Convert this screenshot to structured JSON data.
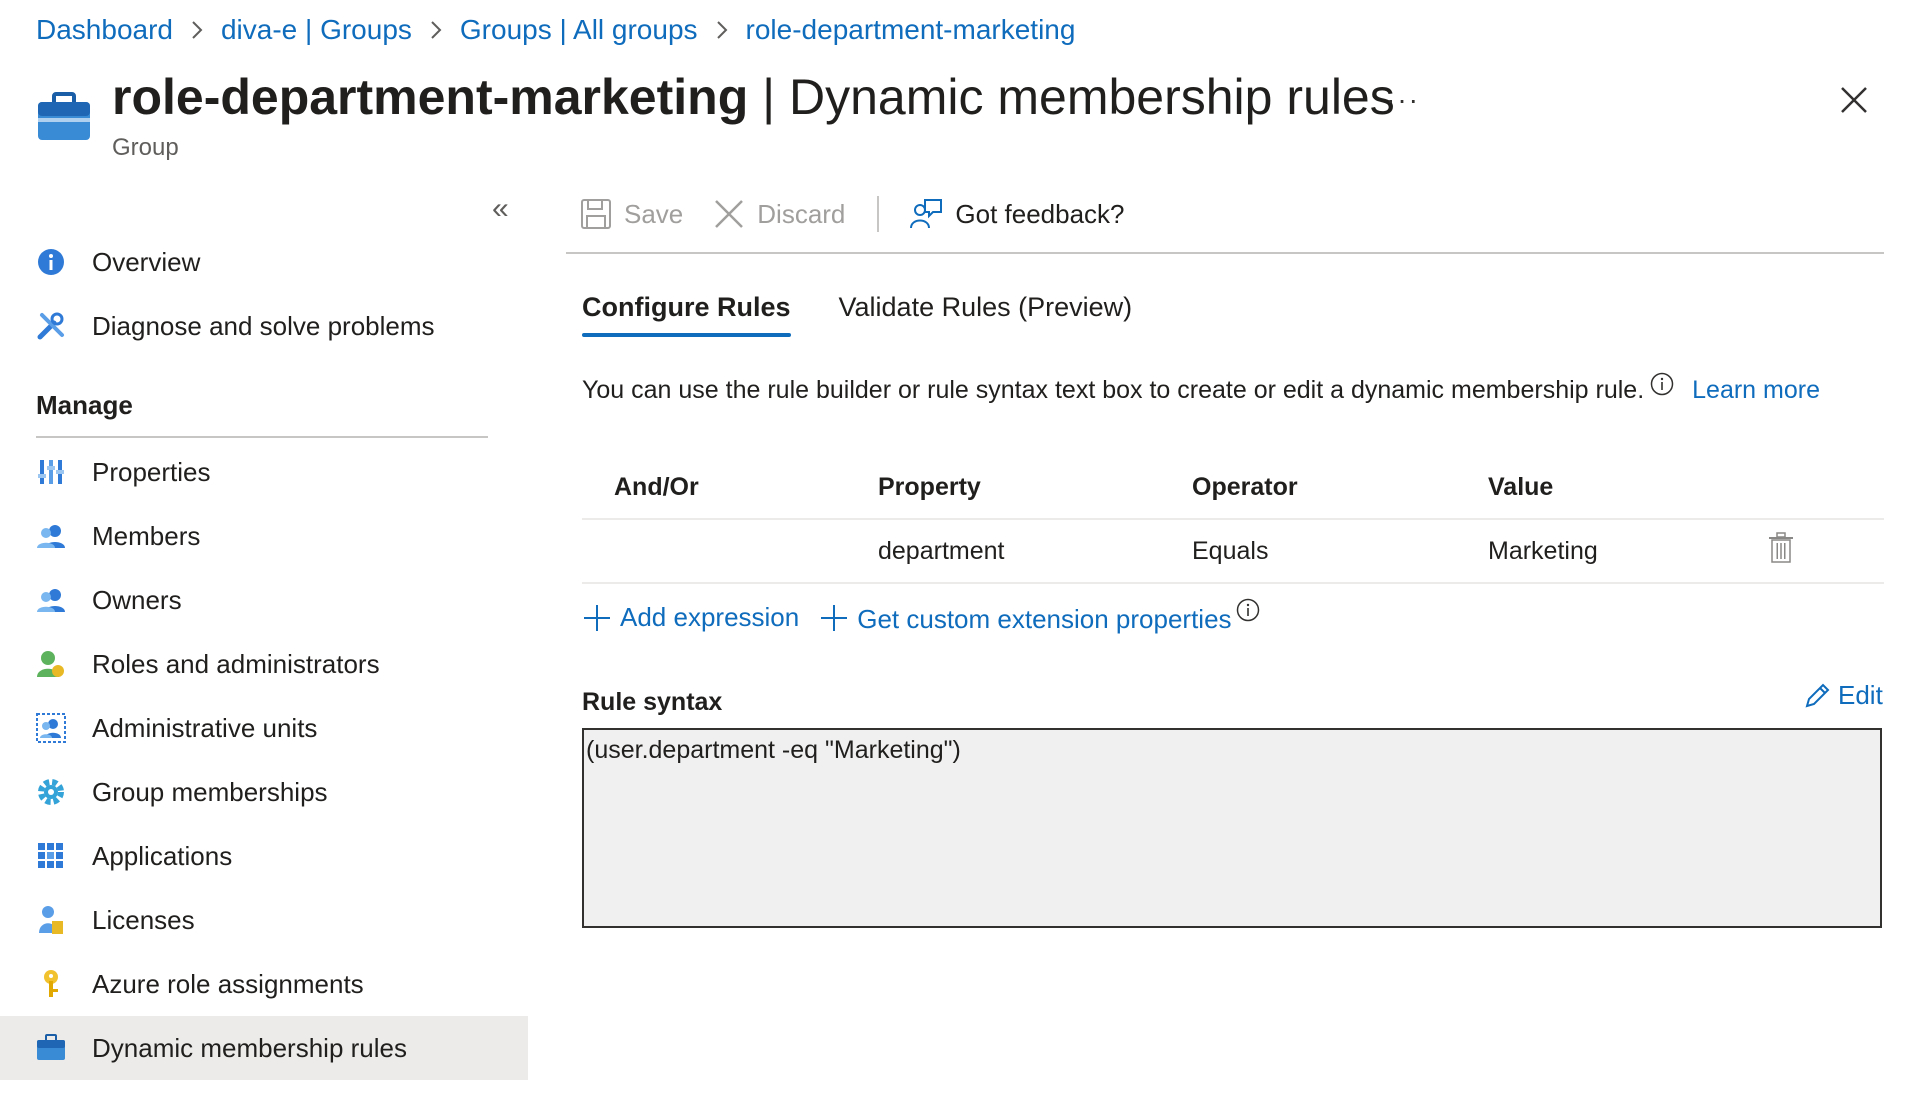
{
  "breadcrumb": {
    "items": [
      "Dashboard",
      "diva-e | Groups",
      "Groups | All groups",
      "role-department-marketing"
    ]
  },
  "header": {
    "title_bold": "role-department-marketing",
    "title_rest": " | Dynamic membership rules",
    "subtitle": "Group",
    "more": "···"
  },
  "sidebar": {
    "collapse": "«",
    "top_items": [
      {
        "label": "Overview",
        "icon": "info-icon"
      },
      {
        "label": "Diagnose and solve problems",
        "icon": "wrench-icon"
      }
    ],
    "section_label": "Manage",
    "items": [
      {
        "label": "Properties",
        "icon": "properties-icon"
      },
      {
        "label": "Members",
        "icon": "members-icon"
      },
      {
        "label": "Owners",
        "icon": "owners-icon"
      },
      {
        "label": "Roles and administrators",
        "icon": "roles-icon"
      },
      {
        "label": "Administrative units",
        "icon": "admin-units-icon"
      },
      {
        "label": "Group memberships",
        "icon": "gear-icon"
      },
      {
        "label": "Applications",
        "icon": "applications-grid-icon"
      },
      {
        "label": "Licenses",
        "icon": "licenses-icon"
      },
      {
        "label": "Azure role assignments",
        "icon": "key-icon"
      },
      {
        "label": "Dynamic membership rules",
        "icon": "briefcase-icon",
        "selected": true
      }
    ]
  },
  "toolbar": {
    "save_label": "Save",
    "discard_label": "Discard",
    "feedback_label": "Got feedback?"
  },
  "tabs": [
    {
      "label": "Configure Rules",
      "active": true
    },
    {
      "label": "Validate Rules (Preview)",
      "active": false
    }
  ],
  "description": {
    "text": "You can use the rule builder or rule syntax text box to create or edit a dynamic membership rule.",
    "learn_more": "Learn more"
  },
  "rules_table": {
    "headers": [
      "And/Or",
      "Property",
      "Operator",
      "Value"
    ],
    "rows": [
      {
        "and_or": "",
        "property": "department",
        "operator": "Equals",
        "value": "Marketing"
      }
    ]
  },
  "actions": {
    "add_expression": "Add expression",
    "custom_extension": "Get custom extension properties"
  },
  "rule_syntax": {
    "label": "Rule syntax",
    "edit_label": "Edit",
    "value": "(user.department -eq \"Marketing\")"
  },
  "colors": {
    "accent": "#0f6cbd",
    "selected_bg": "#edebe9",
    "syntax_bg": "#f0f0f0"
  }
}
